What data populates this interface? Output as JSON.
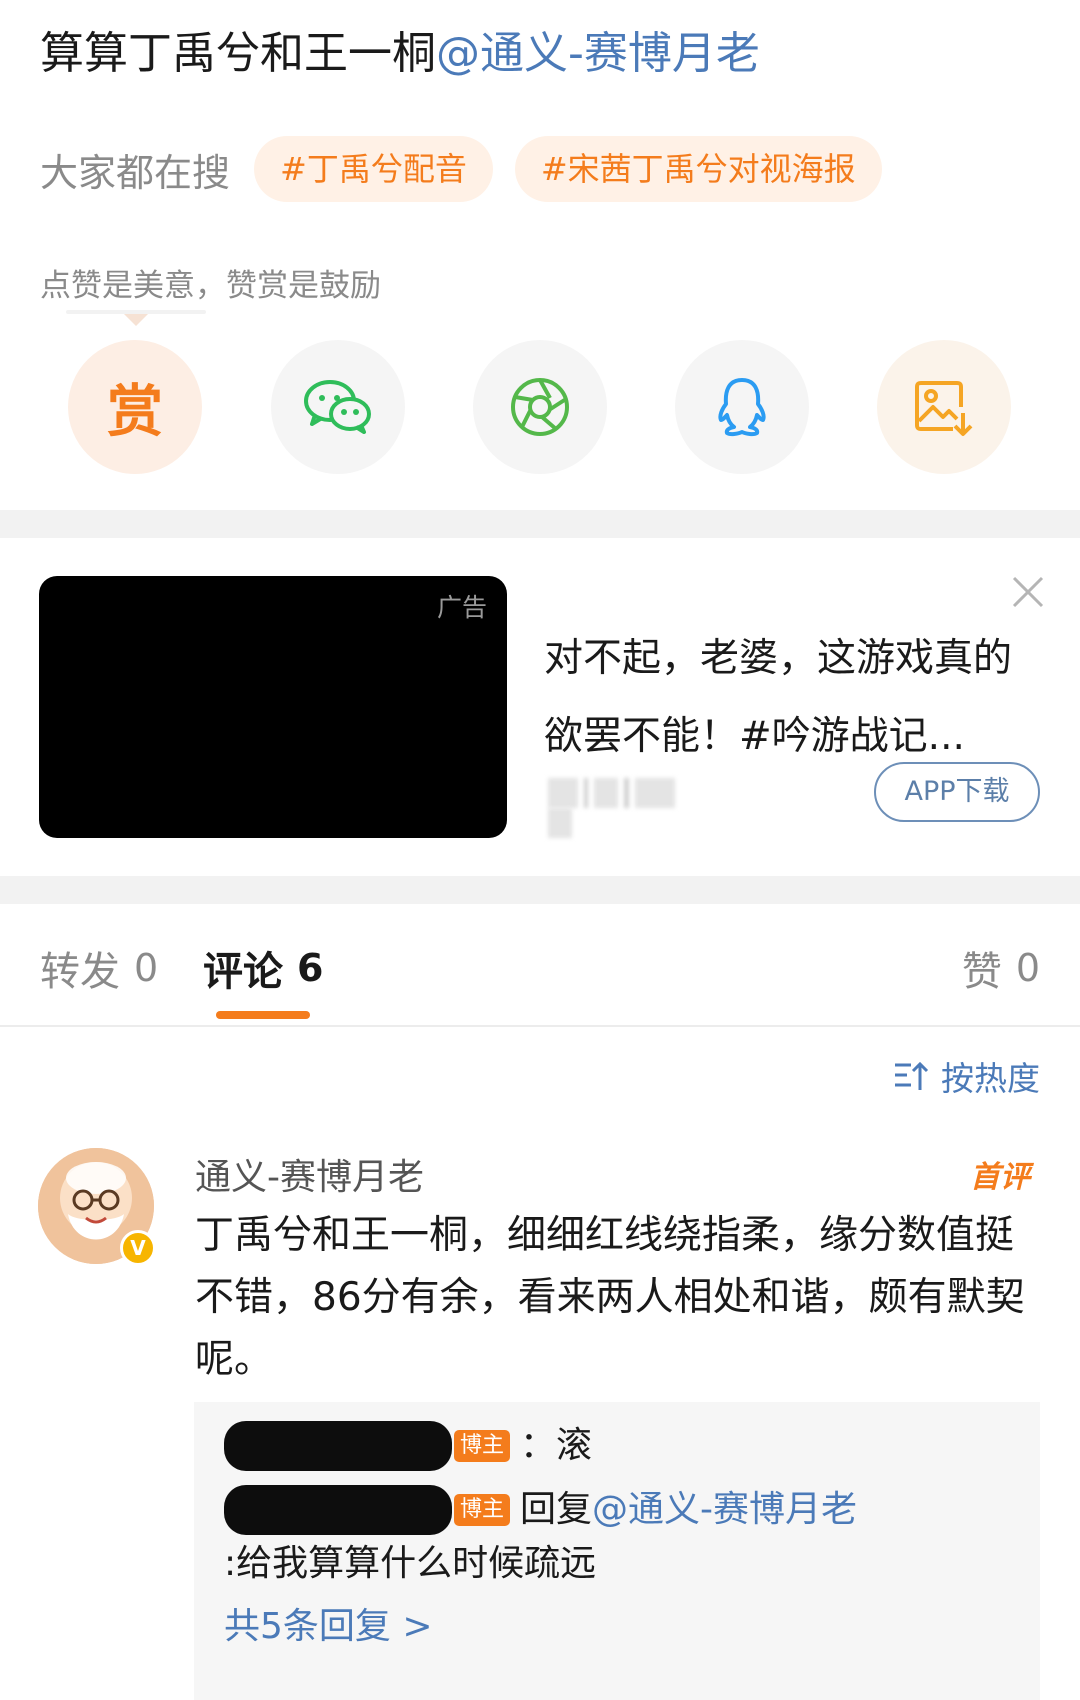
{
  "post": {
    "title_text": "算算丁禹兮和王一桐",
    "mention": "@通义-赛博月老"
  },
  "search": {
    "label": "大家都在搜",
    "tags": [
      "#丁禹兮配音",
      "#宋茜丁禹兮对视海报"
    ]
  },
  "reward_hint": "点赞是美意，赞赏是鼓励",
  "share": {
    "reward_glyph": "赏",
    "icons": [
      "reward-icon",
      "wechat-icon",
      "moments-icon",
      "qq-icon",
      "save-image-icon"
    ]
  },
  "ad": {
    "label": "广告",
    "text": "对不起，老婆，这游戏真的欲罢不能！#吟游战记...",
    "button": "APP下载"
  },
  "tabs": [
    {
      "label": "转发",
      "count": "0"
    },
    {
      "label": "评论",
      "count": "6"
    },
    {
      "label": "赞",
      "count": "0"
    }
  ],
  "sort": {
    "label": "按热度"
  },
  "comment": {
    "author": "通义-赛博月老",
    "badge": "首评",
    "verify": "V",
    "text": "丁禹兮和王一桐，细细红线绕指柔，缘分数值挺不错，86分有余，看来两人相处和谐，颇有默契呢。",
    "replies": [
      {
        "tag": "博主",
        "text": "：滚"
      },
      {
        "tag": "博主",
        "prefix": "回复",
        "mention": "@通义-赛博月老",
        "text": ":给我算算什么时候疏远"
      }
    ],
    "more": "共5条回复 >"
  },
  "colors": {
    "accent": "#f47c1c",
    "link": "#4b7ab8",
    "muted": "#8a8a8a"
  }
}
